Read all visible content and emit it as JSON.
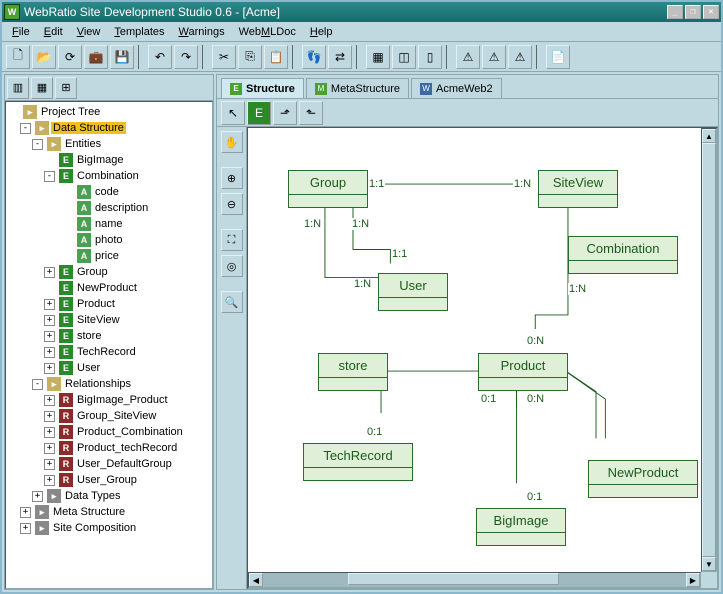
{
  "window": {
    "title": "WebRatio Site Development Studio 0.6 - [Acme]"
  },
  "menus": [
    "File",
    "Edit",
    "View",
    "Templates",
    "Warnings",
    "WebMLDoc",
    "Help"
  ],
  "tree": {
    "root": "Project Tree",
    "data_structure": "Data Structure",
    "entities": "Entities",
    "entity_list": [
      "BigImage",
      "Combination",
      "Group",
      "NewProduct",
      "Product",
      "SiteView",
      "store",
      "TechRecord",
      "User"
    ],
    "combination_attrs": [
      "code",
      "description",
      "name",
      "photo",
      "price"
    ],
    "relationships": "Relationships",
    "relationship_list": [
      "BigImage_Product",
      "Group_SiteView",
      "Product_Combination",
      "Product_techRecord",
      "User_DefaultGroup",
      "User_Group"
    ],
    "data_types": "Data Types",
    "meta_structure": "Meta Structure",
    "site_composition": "Site Composition"
  },
  "tabs": [
    "Structure",
    "MetaStructure",
    "AcmeWeb2"
  ],
  "diagram": {
    "entities": {
      "Group": "Group",
      "SiteView": "SiteView",
      "User": "User",
      "Combination": "Combination",
      "store": "store",
      "Product": "Product",
      "TechRecord": "TechRecord",
      "BigImage": "BigImage",
      "NewProduct": "NewProduct"
    },
    "card": {
      "one_one": "1:1",
      "one_n": "1:N",
      "zero_one": "0:1",
      "zero_n": "0:N"
    }
  }
}
